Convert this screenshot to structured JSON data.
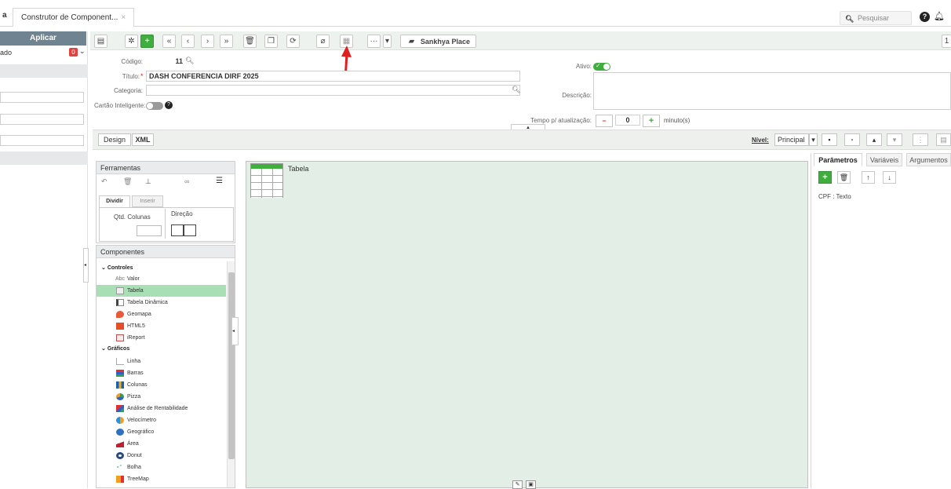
{
  "tabbar": {
    "tab_label": "Construtor de Component...",
    "close": "×",
    "search_placeholder": "Pesquisar",
    "help_icon": "?"
  },
  "left": {
    "aplicar": "Aplicar",
    "status_text": "ado",
    "badge": "0"
  },
  "toolbar": {
    "sankhya_place": "Sankhya Place",
    "more": "···",
    "dropdown": "▾",
    "add": "+"
  },
  "form": {
    "codigo_label": "Código:",
    "codigo_value": "11",
    "titulo_label": "Título:",
    "titulo_required": "*",
    "titulo_value": "DASH CONFERENCIA DIRF 2025",
    "categoria_label": "Categoria:",
    "categoria_value": "",
    "cartao_label": "Cartão Inteligente:",
    "ativo_label": "Ativo:",
    "descricao_label": "Descrição:",
    "tempo_label": "Tempo p/ atualização:",
    "tempo_minus": "−",
    "tempo_value": "0",
    "tempo_plus": "+",
    "tempo_unit": "minuto(s)"
  },
  "designbar": {
    "design": "Design",
    "xml": "XML",
    "nivel_label": "Nível:",
    "nivel_value": "Principal"
  },
  "ferramentas": {
    "title": "Ferramentas",
    "tab_dividir": "Dividir",
    "tab_inserir": "Inserir",
    "qtd_colunas": "Qtd. Colunas",
    "direcao": "Direção"
  },
  "componentes": {
    "title": "Componentes",
    "group_controles": "Controles",
    "controles": [
      "Valor",
      "Tabela",
      "Tabela Dinâmica",
      "Geomapa",
      "HTML5",
      "iReport"
    ],
    "valor_icon": "Abc",
    "group_graficos": "Gráficos",
    "graficos": [
      "Linha",
      "Barras",
      "Colunas",
      "Pizza",
      "Análise de Rentabilidade",
      "Velocímetro",
      "Geográfico",
      "Área",
      "Donut",
      "Bolha",
      "TreeMap"
    ]
  },
  "canvas": {
    "tabela_label": "Tabela"
  },
  "right": {
    "tab_parametros": "Parâmetros",
    "tab_variaveis": "Variáveis",
    "tab_argumentos": "Argumentos",
    "param_item": "CPF : Texto"
  },
  "colors": {
    "green": "#3fae3f",
    "arrow": "#e02020",
    "canvas": "#e2eee6",
    "selected": "#a8dfb4"
  }
}
